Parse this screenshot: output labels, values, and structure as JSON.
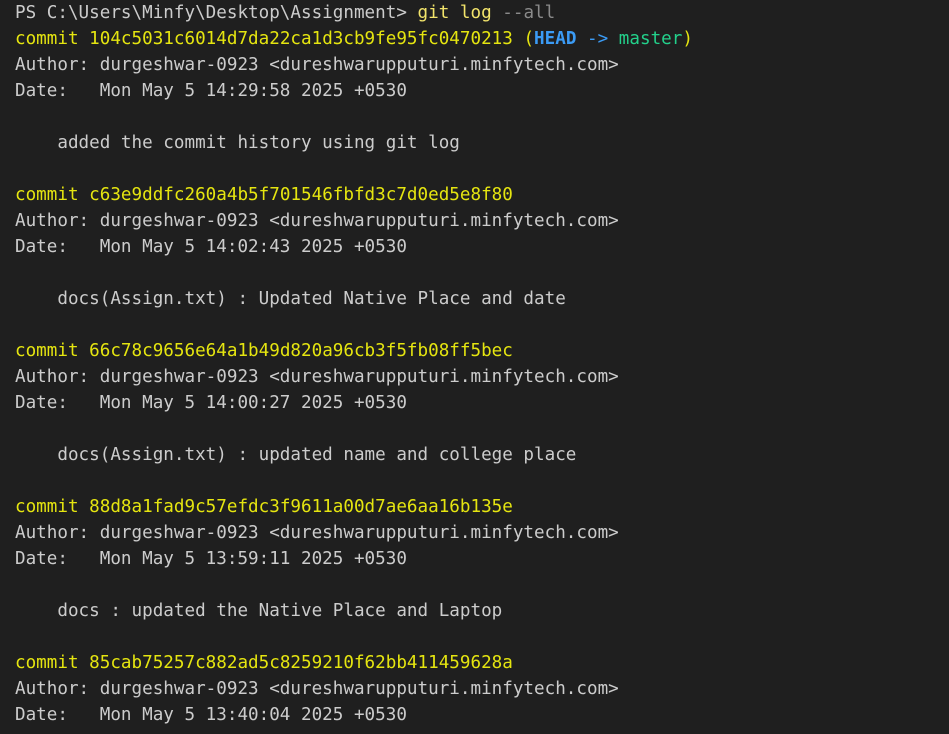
{
  "terminal": {
    "prompt": {
      "path": "PS C:\\Users\\Minfy\\Desktop\\Assignment> ",
      "command": "git log",
      "argument": " --all"
    },
    "commits": [
      {
        "label": "commit",
        "hash": "104c5031c6014d7da22ca1d3cb9fe95fc0470213",
        "refs": {
          "open": " (",
          "head": "HEAD",
          "arrow": " -> ",
          "branch": "master",
          "close": ")"
        },
        "author": "Author: durgeshwar-0923 <dureshwarupputuri.minfytech.com>",
        "date": "Date:   Mon May 5 14:29:58 2025 +0530",
        "message": "    added the commit history using git log"
      },
      {
        "label": "commit",
        "hash": "c63e9ddfc260a4b5f701546fbfd3c7d0ed5e8f80",
        "author": "Author: durgeshwar-0923 <dureshwarupputuri.minfytech.com>",
        "date": "Date:   Mon May 5 14:02:43 2025 +0530",
        "message": "    docs(Assign.txt) : Updated Native Place and date"
      },
      {
        "label": "commit",
        "hash": "66c78c9656e64a1b49d820a96cb3f5fb08ff5bec",
        "author": "Author: durgeshwar-0923 <dureshwarupputuri.minfytech.com>",
        "date": "Date:   Mon May 5 14:00:27 2025 +0530",
        "message": "    docs(Assign.txt) : updated name and college place"
      },
      {
        "label": "commit",
        "hash": "88d8a1fad9c57efdc3f9611a00d7ae6aa16b135e",
        "author": "Author: durgeshwar-0923 <dureshwarupputuri.minfytech.com>",
        "date": "Date:   Mon May 5 13:59:11 2025 +0530",
        "message": "    docs : updated the Native Place and Laptop"
      },
      {
        "label": "commit",
        "hash": "85cab75257c882ad5c8259210f62bb411459628a",
        "author": "Author: durgeshwar-0923 <dureshwarupputuri.minfytech.com>",
        "date": "Date:   Mon May 5 13:40:04 2025 +0530"
      }
    ]
  },
  "colors": {
    "background": "#1f1f1f",
    "text": "#cccccc",
    "commit_yellow": "#e5e510",
    "head_blue": "#3b9bf5",
    "branch_green": "#23d18b",
    "command_yellow": "#f2e46b",
    "argument_gray": "#8a8a8a"
  }
}
